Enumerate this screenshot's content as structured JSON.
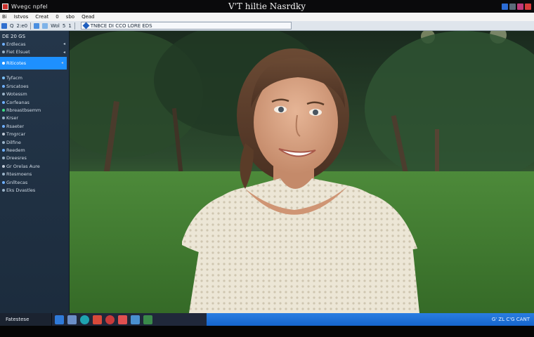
{
  "window": {
    "app_name": "Wvegc npfel",
    "title": "V'T hiltie Nasrdky"
  },
  "menu": [
    "Bi",
    "Istvos",
    "Creat",
    "0",
    "sbo",
    "Qead"
  ],
  "toolbar": {
    "items": [
      "Q",
      "2:e0",
      "Wol",
      "5",
      "1"
    ],
    "address": "TNBCE DI CCO LORE EDS"
  },
  "sidebar": {
    "header": "DE 20 GS",
    "items": [
      {
        "label": "Erdlecas",
        "arrow": "◂"
      },
      {
        "label": "Fiet Elsuet",
        "arrow": "◂"
      },
      {
        "label": "Riticotes",
        "arrow": "◂",
        "active": true
      },
      {
        "label": "Tyfacm"
      },
      {
        "label": "Srscatoes"
      },
      {
        "label": "Wotessm"
      },
      {
        "label": "Corfeanas"
      },
      {
        "label": "Rbreastbsemm"
      },
      {
        "label": "Krser"
      },
      {
        "label": "Rsaeter"
      },
      {
        "label": "Tmgrcar"
      },
      {
        "label": "Dilfine"
      },
      {
        "label": "Reedem"
      },
      {
        "label": "Dreesres"
      },
      {
        "label": "Gr Orelas Aure"
      },
      {
        "label": "Rtesmoens"
      },
      {
        "label": "Gnlltecas"
      },
      {
        "label": "Eks Dvastles"
      }
    ]
  },
  "taskbar": {
    "start_label": "Fatestese",
    "tray_text": "G' ZL C'G CANT"
  },
  "colors": {
    "accent": "#1e90ff",
    "sidebar_bg": "#24364a",
    "taskbar_tray": "#1565cc"
  }
}
